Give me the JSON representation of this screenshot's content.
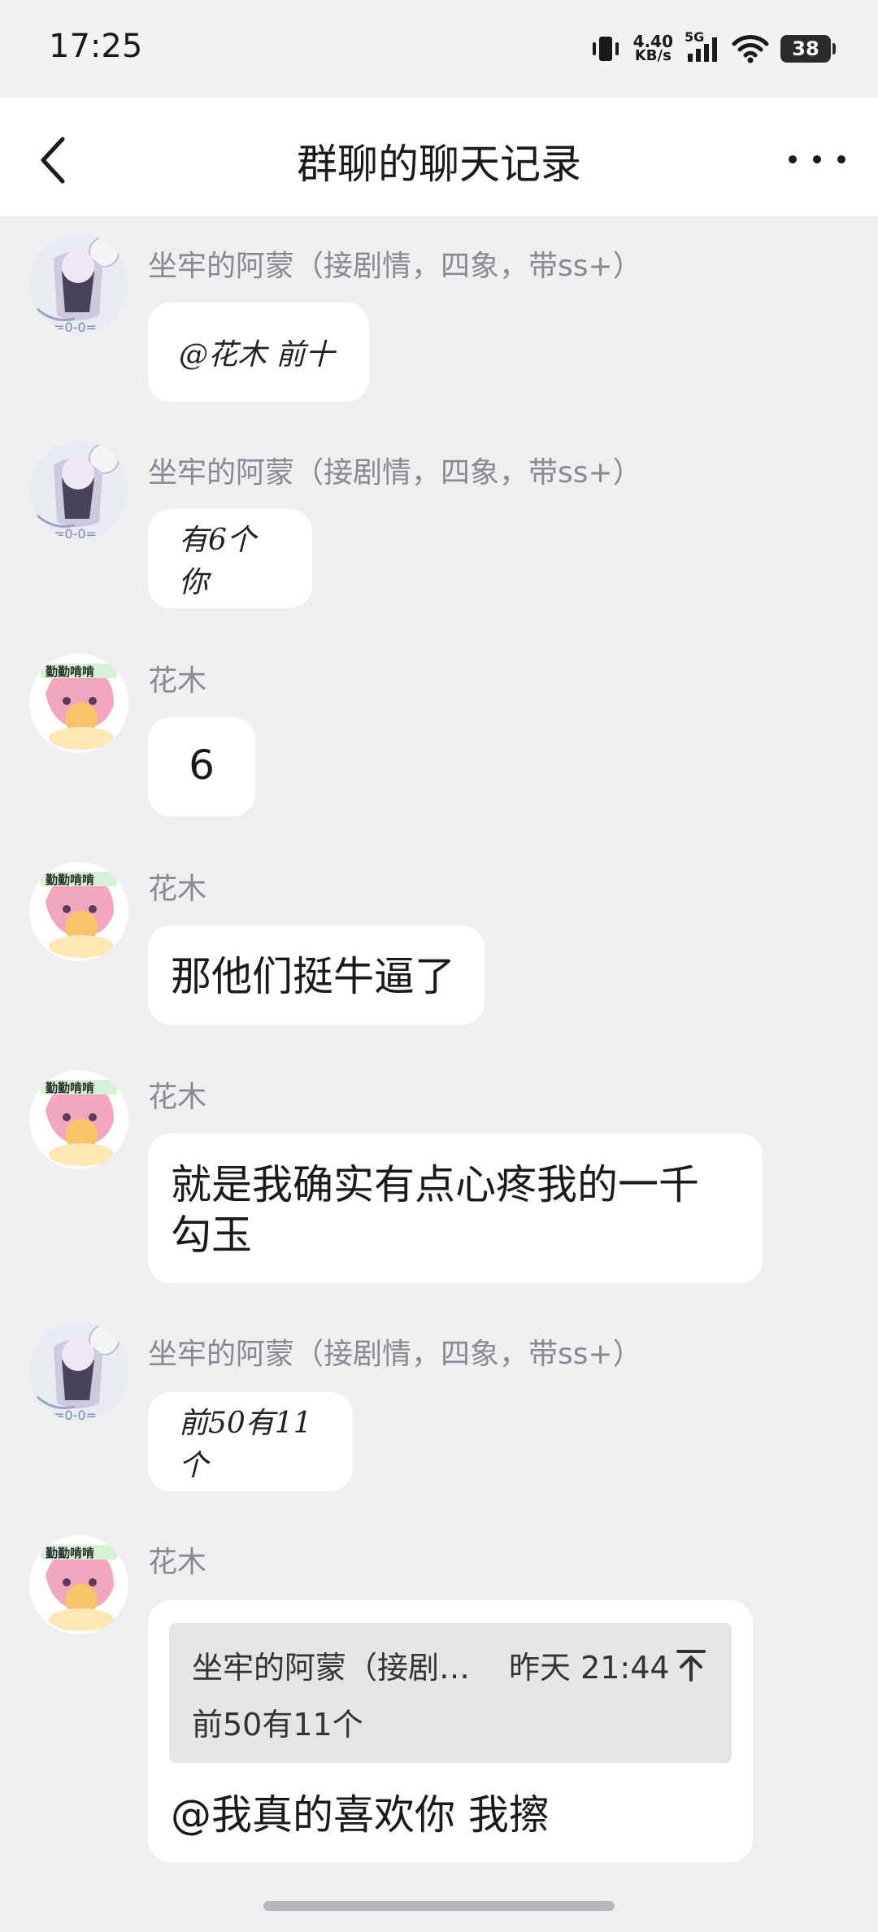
{
  "status_bar": {
    "time": "17:25",
    "net_speed_value": "4.40",
    "net_speed_unit": "KB/s",
    "network": "5G",
    "battery": "38"
  },
  "header": {
    "title": "群聊的聊天记录",
    "back_icon": "chevron-left-icon",
    "more_icon": "more-dots-icon"
  },
  "messages": [
    {
      "sender": "坐牢的阿蒙（接剧情，四象，带ss+）",
      "text": "@花木  前十",
      "style": "handwritten"
    },
    {
      "sender": "坐牢的阿蒙（接剧情，四象，带ss+）",
      "text": "有6个你",
      "style": "handwritten"
    },
    {
      "sender": "花木",
      "text": "6",
      "style": "text"
    },
    {
      "sender": "花木",
      "text": "那他们挺牛逼了",
      "style": "text"
    },
    {
      "sender": "花木",
      "text": "就是我确实有点心疼我的一千勾玉",
      "style": "text"
    },
    {
      "sender": "坐牢的阿蒙（接剧情，四象，带ss+）",
      "text": "前50有11个",
      "style": "handwritten"
    },
    {
      "sender": "花木",
      "quote": {
        "author": "坐牢的阿蒙（接剧…",
        "time": "昨天 21:44",
        "text": "前50有11个"
      },
      "text": "@我真的喜欢你 我擦",
      "style": "reply"
    }
  ],
  "colors": {
    "background": "#efeff2",
    "bubble": "#ffffff",
    "sender": "#8a8a8e",
    "quote_bg": "#e5e5e7"
  }
}
